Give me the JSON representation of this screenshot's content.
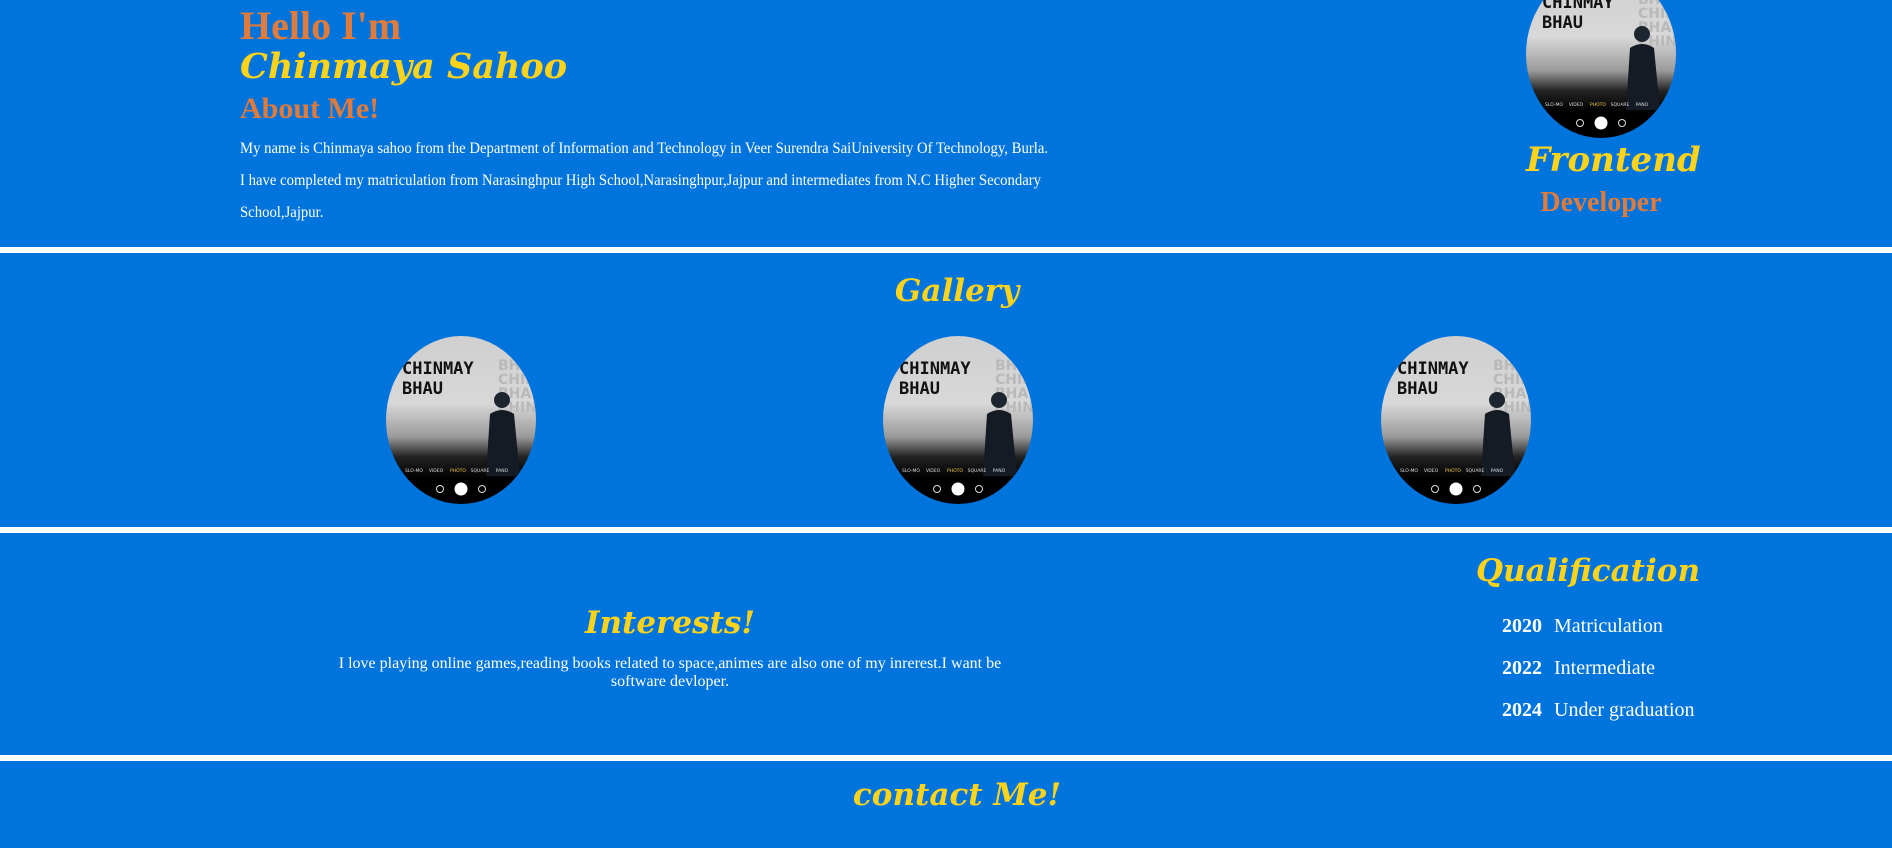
{
  "hero": {
    "greeting": "Hello I'm",
    "name": "Chinmaya Sahoo",
    "about_heading": "About Me!",
    "bio": "My name is Chinmaya sahoo from the Department of Information and Technology in Veer Surendra SaiUniversity Of Technology, Burla. I have completed my matriculation from Narasinghpur High School,Narasinghpur,Jajpur and intermediates from N.C Higher Secondary School,Jajpur.",
    "role_line1": "Frontend",
    "role_line2": "Developer"
  },
  "photo": {
    "overlay_line1": "CHINMAY",
    "overlay_line2": "BHAU",
    "faded_text": [
      "BHAU",
      "CHIN",
      "BHAU",
      "CHIN"
    ],
    "camera_modes": [
      "SLO-MO",
      "VIDEO",
      "PHOTO",
      "SQUARE",
      "PANO"
    ]
  },
  "gallery": {
    "title": "Gallery"
  },
  "interests": {
    "title": "Interests!",
    "text": "I love playing online games,reading books related to space,animes are also one of my inrerest.I want be software devloper."
  },
  "qualification": {
    "title": "Qualification",
    "items": [
      {
        "year": "2020",
        "label": "Matriculation"
      },
      {
        "year": "2022",
        "label": "Intermediate"
      },
      {
        "year": "2024",
        "label": "Under graduation"
      }
    ]
  },
  "contact": {
    "title": "contact Me!"
  },
  "colors": {
    "background": "#0074dd",
    "accent_orange": "#e07b3c",
    "accent_yellow": "#ffd319",
    "divider": "#ffffff"
  }
}
